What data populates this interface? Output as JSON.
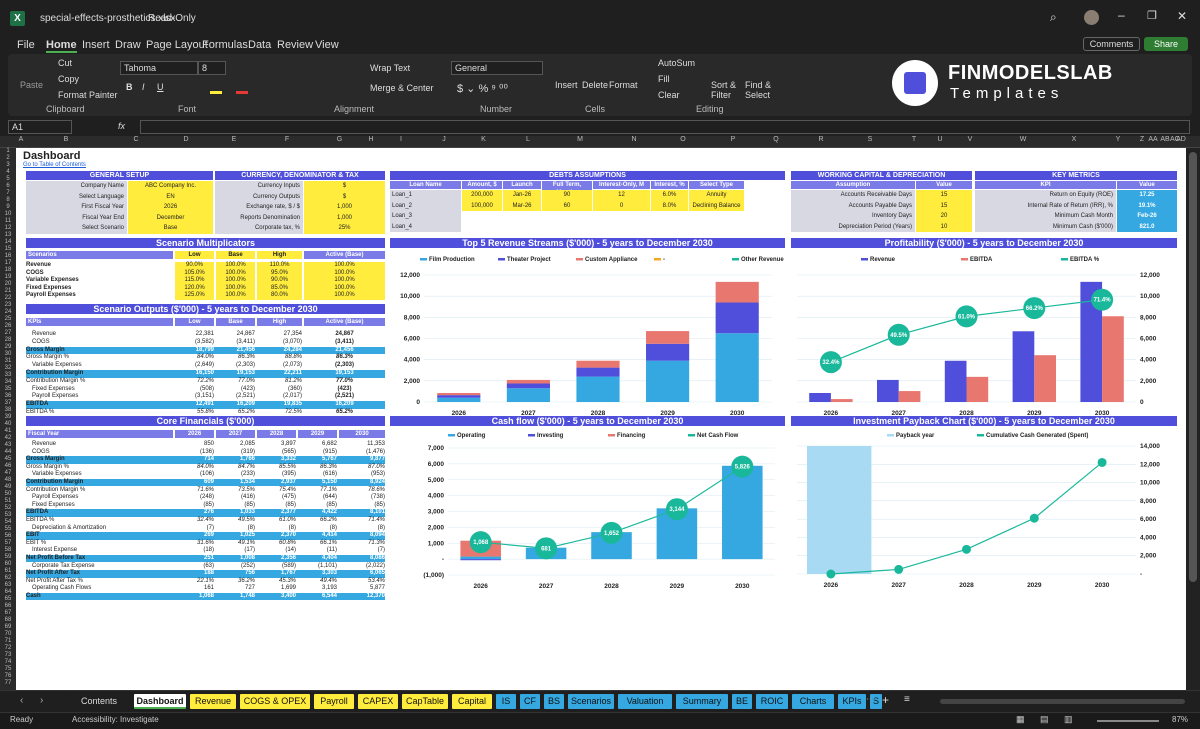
{
  "app": {
    "file_name": "special-effects-prosthetics.xlsx",
    "mode": "Read-Only",
    "comments_label": "Comments",
    "share_label": "Share"
  },
  "menu": [
    "File",
    "Home",
    "Insert",
    "Draw",
    "Page Layout",
    "Formulas",
    "Data",
    "Review",
    "View"
  ],
  "ribbon": {
    "clipboard": {
      "paste": "Paste",
      "cut": "Cut",
      "copy": "Copy",
      "format_painter": "Format Painter",
      "group": "Clipboard"
    },
    "font": {
      "name": "Tahoma",
      "size": "8",
      "group": "Font"
    },
    "alignment": {
      "wrap": "Wrap Text",
      "merge": "Merge & Center",
      "group": "Alignment"
    },
    "number": {
      "format": "General",
      "group": "Number"
    },
    "cells": {
      "insert": "Insert",
      "delete": "Delete",
      "format": "Format",
      "group": "Cells"
    },
    "editing": {
      "autosum": "AutoSum",
      "fill": "Fill",
      "clear": "Clear",
      "sort": "Sort & Filter",
      "find": "Find & Select",
      "group": "Editing"
    },
    "logo_title": "FINMODELSLAB",
    "logo_sub": "Templates"
  },
  "formula_bar": {
    "cell": "A1",
    "fx": "fx"
  },
  "columns": [
    "A",
    "B",
    "C",
    "D",
    "E",
    "F",
    "G",
    "H",
    "I",
    "J",
    "K",
    "L",
    "M",
    "N",
    "O",
    "P",
    "Q",
    "R",
    "S",
    "T",
    "U",
    "V",
    "W",
    "X",
    "Y",
    "Z",
    "AA",
    "AB",
    "AC",
    "AD"
  ],
  "rows": [
    "1",
    "2",
    "3",
    "4",
    "5",
    "6",
    "7",
    "8",
    "9",
    "10",
    "11",
    "12",
    "13",
    "14",
    "15",
    "16",
    "17",
    "18",
    "19",
    "20",
    "21",
    "22",
    "23",
    "24",
    "25",
    "26",
    "27",
    "28",
    "29",
    "30",
    "31",
    "32",
    "33",
    "34",
    "35",
    "36",
    "37",
    "38",
    "39",
    "40",
    "41",
    "42",
    "43",
    "44",
    "45",
    "46",
    "47",
    "48",
    "49",
    "50",
    "51",
    "52",
    "53",
    "54",
    "55",
    "56",
    "57",
    "58",
    "59",
    "60",
    "61",
    "62",
    "63",
    "64",
    "65",
    "66",
    "67",
    "68",
    "69",
    "70",
    "71",
    "72",
    "73",
    "74",
    "75",
    "76",
    "77"
  ],
  "dashboard": {
    "title": "Dashboard",
    "toc_link": "Go to Table of Contents"
  },
  "general_setup": {
    "title": "GENERAL SETUP",
    "rows": [
      [
        "Company Name",
        "ABC Company Inc."
      ],
      [
        "Select Language",
        "EN"
      ],
      [
        "First Fiscal Year",
        "2026"
      ],
      [
        "Fiscal Year End",
        "December"
      ],
      [
        "Select Scenario",
        "Base"
      ]
    ]
  },
  "currency": {
    "title": "CURRENCY, DENOMINATOR & TAX",
    "rows": [
      [
        "Currency Inputs",
        "$"
      ],
      [
        "Currency Outputs",
        "$"
      ],
      [
        "Exchange rate, $ / $",
        "1,000"
      ],
      [
        "Reports Denomination",
        "1,000"
      ],
      [
        "Corporate tax, %",
        "25%"
      ]
    ]
  },
  "debts": {
    "title": "DEBTS ASSUMPTIONS",
    "headers": [
      "Loan Name",
      "Amount, $",
      "Launch",
      "Full Term, Months",
      "Interest-Only, M",
      "Interest, %",
      "Select Type"
    ],
    "rows": [
      [
        "Loan_1",
        "200,000",
        "Jan-26",
        "90",
        "12",
        "6.0%",
        "Annuity"
      ],
      [
        "Loan_2",
        "100,000",
        "Mar-26",
        "60",
        "0",
        "8.0%",
        "Declining Balance"
      ],
      [
        "Loan_3",
        "",
        "",
        "",
        "",
        "",
        ""
      ],
      [
        "Loan_4",
        "",
        "",
        "",
        "",
        "",
        ""
      ]
    ]
  },
  "wc": {
    "title": "WORKING CAPITAL & DEPRECIATION",
    "headers": [
      "Assumption",
      "Value"
    ],
    "rows": [
      [
        "Accounts Receivable Days",
        "15"
      ],
      [
        "Accounts Payable Days",
        "15"
      ],
      [
        "Inventory Days",
        "20"
      ],
      [
        "Depreciation Period (Years)",
        "10"
      ]
    ]
  },
  "kpi": {
    "title": "KEY METRICS",
    "headers": [
      "KPI",
      "Value"
    ],
    "rows": [
      [
        "Return on Equity (ROE)",
        "17.25"
      ],
      [
        "Internal Rate of Return (IRR), %",
        "19.1%"
      ],
      [
        "Minimum Cash Month",
        "Feb-26"
      ],
      [
        "Minimum Cash ($'000)",
        "821.0"
      ]
    ]
  },
  "scen_mult": {
    "title": "Scenario Multiplicators",
    "headers": [
      "Scenarios",
      "Low",
      "Base",
      "High",
      "Active (Base)"
    ],
    "rows": [
      [
        "Revenue",
        "90.0%",
        "100.0%",
        "110.0%",
        "100.0%"
      ],
      [
        "COGS",
        "105.0%",
        "100.0%",
        "95.0%",
        "100.0%"
      ],
      [
        "Variable Expenses",
        "115.0%",
        "100.0%",
        "90.0%",
        "100.0%"
      ],
      [
        "Fixed Expenses",
        "120.0%",
        "100.0%",
        "85.0%",
        "100.0%"
      ],
      [
        "Payroll Expenses",
        "125.0%",
        "100.0%",
        "80.0%",
        "100.0%"
      ]
    ]
  },
  "scen_out": {
    "title": "Scenario Outputs ($'000) - 5 years to December 2030",
    "headers": [
      "KPIs",
      "Low",
      "Base",
      "High",
      "Active (Base)"
    ],
    "rows": [
      [
        "Revenue",
        "22,381",
        "24,867",
        "27,354",
        "24,867",
        "n"
      ],
      [
        "COGS",
        "(3,582)",
        "(3,411)",
        "(3,070)",
        "(3,411)",
        "n"
      ],
      [
        "Gross Margin",
        "18,799",
        "21,456",
        "24,284",
        "21,456",
        "b"
      ],
      [
        "Gross Margin %",
        "84.0%",
        "86.3%",
        "88.8%",
        "86.3%",
        "i"
      ],
      [
        "Variable Expenses",
        "(2,649)",
        "(2,303)",
        "(2,073)",
        "(2,303)",
        "n"
      ],
      [
        "Contribution Margin",
        "16,150",
        "19,153",
        "22,211",
        "19,153",
        "b"
      ],
      [
        "Contribution Margin %",
        "72.2%",
        "77.0%",
        "81.2%",
        "77.0%",
        "i"
      ],
      [
        "Fixed Expenses",
        "(508)",
        "(423)",
        "(360)",
        "(423)",
        "n"
      ],
      [
        "Payroll Expenses",
        "(3,151)",
        "(2,521)",
        "(2,017)",
        "(2,521)",
        "n"
      ],
      [
        "EBITDA",
        "12,491",
        "16,209",
        "19,835",
        "16,209",
        "b"
      ],
      [
        "EBITDA %",
        "55.8%",
        "65.2%",
        "72.5%",
        "65.2%",
        "i"
      ]
    ]
  },
  "core": {
    "title": "Core Financials ($'000)",
    "headers": [
      "Fiscal Year",
      "2026",
      "2027",
      "2028",
      "2029",
      "2030"
    ],
    "rows": [
      [
        "Revenue",
        "850",
        "2,085",
        "3,897",
        "6,682",
        "11,353",
        "n"
      ],
      [
        "COGS",
        "(136)",
        "(319)",
        "(565)",
        "(915)",
        "(1,476)",
        "n"
      ],
      [
        "Gross Margin",
        "714",
        "1,766",
        "3,332",
        "5,767",
        "9,877",
        "b"
      ],
      [
        "Gross Margin %",
        "84.0%",
        "84.7%",
        "85.5%",
        "86.3%",
        "87.0%",
        "i"
      ],
      [
        "Variable Expenses",
        "(106)",
        "(233)",
        "(395)",
        "(616)",
        "(953)",
        "n"
      ],
      [
        "Contribution Margin",
        "609",
        "1,534",
        "2,937",
        "5,150",
        "8,924",
        "b"
      ],
      [
        "Contribution Margin %",
        "71.6%",
        "73.5%",
        "75.4%",
        "77.1%",
        "78.6%",
        "i"
      ],
      [
        "Payroll Expenses",
        "(248)",
        "(416)",
        "(475)",
        "(644)",
        "(738)",
        "n"
      ],
      [
        "Fixed Expenses",
        "(85)",
        "(85)",
        "(85)",
        "(85)",
        "(85)",
        "n"
      ],
      [
        "EBITDA",
        "276",
        "1,033",
        "2,377",
        "4,422",
        "8,101",
        "b"
      ],
      [
        "EBITDA %",
        "32.4%",
        "49.5%",
        "61.0%",
        "66.2%",
        "71.4%",
        "i"
      ],
      [
        "Depreciation & Amortization",
        "(7)",
        "(8)",
        "(8)",
        "(8)",
        "(8)",
        "n"
      ],
      [
        "EBIT",
        "269",
        "1,025",
        "2,370",
        "4,414",
        "8,094",
        "b"
      ],
      [
        "EBIT %",
        "31.6%",
        "49.1%",
        "60.8%",
        "66.1%",
        "71.3%",
        "i"
      ],
      [
        "Interest Expense",
        "(18)",
        "(17)",
        "(14)",
        "(11)",
        "(7)",
        "n"
      ],
      [
        "Net Profit Before Tax",
        "251",
        "1,008",
        "2,356",
        "4,404",
        "8,086",
        "b"
      ],
      [
        "Corporate Tax Expense",
        "(63)",
        "(252)",
        "(589)",
        "(1,101)",
        "(2,022)",
        "n"
      ],
      [
        "Net Profit After Tax",
        "188",
        "756",
        "1,767",
        "3,303",
        "6,065",
        "b"
      ],
      [
        "Net Profit After Tax %",
        "22.1%",
        "36.2%",
        "45.3%",
        "49.4%",
        "53.4%",
        "i"
      ],
      [
        "Operating Cash Flows",
        "161",
        "727",
        "1,699",
        "3,193",
        "5,877",
        "n"
      ],
      [
        "Cash",
        "1,068",
        "1,748",
        "3,400",
        "6,544",
        "12,370",
        "b"
      ]
    ]
  },
  "tabs": [
    {
      "label": "Contents",
      "color": "#1f1f1f",
      "fg": "#ddd"
    },
    {
      "label": "Dashboard",
      "color": "#ffffff",
      "fg": "#111"
    },
    {
      "label": "Revenue",
      "color": "#ffec3d",
      "fg": "#111"
    },
    {
      "label": "COGS & OPEX",
      "color": "#ffec3d",
      "fg": "#111"
    },
    {
      "label": "Payroll",
      "color": "#ffec3d",
      "fg": "#111"
    },
    {
      "label": "CAPEX",
      "color": "#ffec3d",
      "fg": "#111"
    },
    {
      "label": "CapTable",
      "color": "#ffec3d",
      "fg": "#111"
    },
    {
      "label": "Capital",
      "color": "#ffec3d",
      "fg": "#111"
    },
    {
      "label": "IS",
      "color": "#35a8e2",
      "fg": "#111"
    },
    {
      "label": "CF",
      "color": "#35a8e2",
      "fg": "#111"
    },
    {
      "label": "BS",
      "color": "#35a8e2",
      "fg": "#111"
    },
    {
      "label": "Scenarios",
      "color": "#35a8e2",
      "fg": "#111"
    },
    {
      "label": "Valuation",
      "color": "#35a8e2",
      "fg": "#111"
    },
    {
      "label": "Summary",
      "color": "#35a8e2",
      "fg": "#111"
    },
    {
      "label": "BE",
      "color": "#35a8e2",
      "fg": "#111"
    },
    {
      "label": "ROIC",
      "color": "#35a8e2",
      "fg": "#111"
    },
    {
      "label": "Charts",
      "color": "#35a8e2",
      "fg": "#111"
    },
    {
      "label": "KPIs",
      "color": "#35a8e2",
      "fg": "#111"
    },
    {
      "label": "S",
      "color": "#35a8e2",
      "fg": "#111"
    }
  ],
  "status": {
    "ready": "Ready",
    "accessibility": "Accessibility: Investigate",
    "zoom": "87%"
  },
  "chart_data": [
    {
      "type": "bar",
      "title": "Top 5 Revenue Streams ($'000) - 5 years to December 2030",
      "categories": [
        "2026",
        "2027",
        "2028",
        "2029",
        "2030"
      ],
      "ylim": [
        0,
        12000
      ],
      "yticks": [
        "0",
        "2,000",
        "4,000",
        "6,000",
        "8,000",
        "10,000",
        "12,000"
      ],
      "series": [
        {
          "name": "Film Production",
          "color": "#35a8e2",
          "values": [
            400,
            1300,
            2400,
            3900,
            6500
          ]
        },
        {
          "name": "Theater Project",
          "color": "#4f4fdb",
          "values": [
            250,
            450,
            850,
            1600,
            2900
          ]
        },
        {
          "name": "Custom Appliance",
          "color": "#e8776f",
          "values": [
            200,
            335,
            650,
            1200,
            1950
          ]
        },
        {
          "name": "-",
          "color": "#f5a623",
          "values": [
            0,
            0,
            0,
            0,
            0
          ]
        },
        {
          "name": "Other Revenue",
          "color": "#1ab89b",
          "values": [
            0,
            0,
            0,
            0,
            0
          ]
        }
      ]
    },
    {
      "type": "bar",
      "title": "Profitability ($'000) - 5 years to December 2030",
      "categories": [
        "2026",
        "2027",
        "2028",
        "2029",
        "2030"
      ],
      "ylim": [
        0,
        12000
      ],
      "yticks": [
        "0",
        "2,000",
        "4,000",
        "6,000",
        "8,000",
        "10,000",
        "12,000"
      ],
      "series": [
        {
          "name": "Revenue",
          "color": "#4f4fdb",
          "values": [
            850,
            2085,
            3897,
            6682,
            11353
          ]
        },
        {
          "name": "EBITDA",
          "color": "#e8776f",
          "values": [
            276,
            1033,
            2377,
            4422,
            8101
          ]
        }
      ],
      "line": {
        "name": "EBITDA %",
        "color": "#1ab89b",
        "labels": [
          "32.4%",
          "49.5%",
          "61.0%",
          "66.2%",
          "71.4%"
        ],
        "values": [
          32.4,
          49.5,
          61.0,
          66.2,
          71.4
        ]
      }
    },
    {
      "type": "bar",
      "title": "Cash flow ($'000) - 5 years to December 2030",
      "categories": [
        "2026",
        "2027",
        "2028",
        "2029",
        "2030"
      ],
      "ylim": [
        -1000,
        7000
      ],
      "yticks": [
        "(1,000)",
        "-",
        "1,000",
        "2,000",
        "3,000",
        "4,000",
        "5,000",
        "6,000",
        "7,000"
      ],
      "series": [
        {
          "name": "Operating",
          "color": "#35a8e2",
          "values": [
            160,
            720,
            1700,
            3200,
            5880
          ]
        },
        {
          "name": "Investing",
          "color": "#4f4fdb",
          "values": [
            -70,
            0,
            0,
            0,
            0
          ]
        },
        {
          "name": "Financing",
          "color": "#e8776f",
          "values": [
            1000,
            0,
            0,
            0,
            0
          ]
        }
      ],
      "line": {
        "name": "Net Cash Flow",
        "color": "#1ab89b",
        "labels": [
          "1,068",
          "681",
          "1,652",
          "3,144",
          "5,826"
        ],
        "values": [
          1068,
          681,
          1652,
          3144,
          5826
        ]
      }
    },
    {
      "type": "line",
      "title": "Investment Payback Chart ($'000) - 5 years to December 2030",
      "categories": [
        "2026",
        "2027",
        "2028",
        "2029",
        "2030"
      ],
      "ylim": [
        0,
        14000
      ],
      "yticks": [
        "-",
        "2,000",
        "4,000",
        "6,000",
        "8,000",
        "10,000",
        "12,000",
        "14,000"
      ],
      "series": [
        {
          "name": "Payback year",
          "color": "#a9daf3",
          "values": [
            1,
            0,
            0,
            0,
            0
          ]
        },
        {
          "name": "Cumulative Cash Generated (Spent)",
          "color": "#1ab89b",
          "values": [
            0,
            500,
            2700,
            6100,
            12200
          ]
        }
      ]
    }
  ]
}
